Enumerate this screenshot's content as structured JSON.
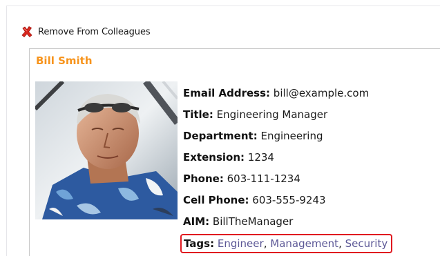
{
  "action": {
    "remove_label": "Remove From Colleagues",
    "remove_icon": "red-x-icon"
  },
  "profile": {
    "name": "Bill Smith",
    "photo_alt": "profile-photo",
    "fields": [
      {
        "label": "Email Address:",
        "value": "bill@example.com"
      },
      {
        "label": "Title:",
        "value": "Engineering Manager"
      },
      {
        "label": "Department:",
        "value": "Engineering"
      },
      {
        "label": "Extension:",
        "value": "1234"
      },
      {
        "label": "Phone:",
        "value": "603-111-1234"
      },
      {
        "label": "Cell Phone:",
        "value": "603-555-9243"
      },
      {
        "label": "AIM:",
        "value": "BillTheManager"
      }
    ],
    "tags_label": "Tags:",
    "tags": [
      "Engineer",
      "Management",
      "Security"
    ],
    "tag_separator": ","
  },
  "colors": {
    "name": "#f7941d",
    "tag_link": "#5b5796",
    "highlight": "#e0181f"
  }
}
